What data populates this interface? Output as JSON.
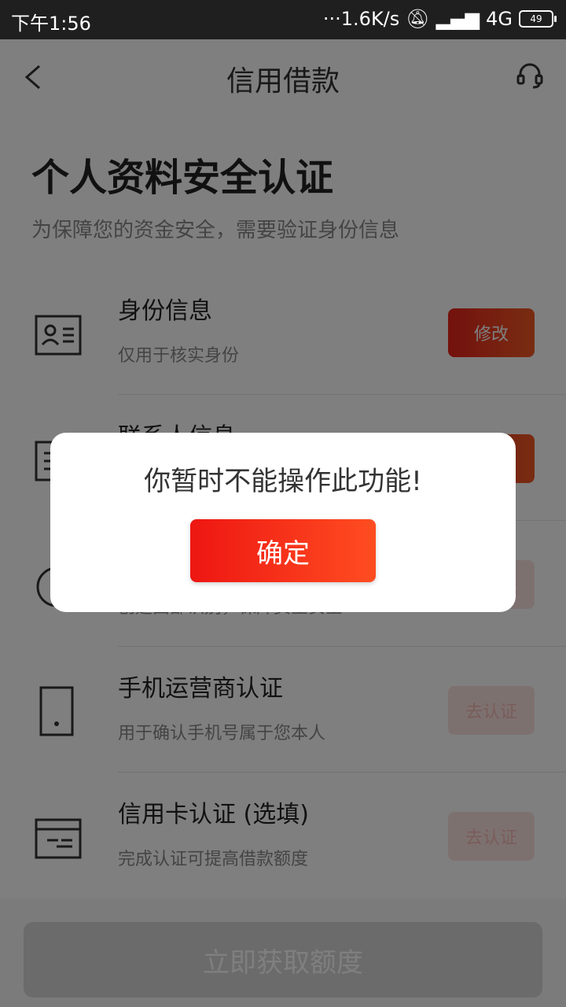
{
  "status_bar": {
    "time": "下午1:56",
    "speed": "···1.6K/s",
    "network": "4G",
    "battery": "49"
  },
  "header": {
    "title": "信用借款"
  },
  "main": {
    "heading": "个人资料安全认证",
    "subheading": "为保障您的资金安全，需要验证身份信息",
    "items": [
      {
        "title": "身份信息",
        "desc": "仅用于核实身份",
        "button": "修改",
        "icon": "id-card-icon"
      },
      {
        "title": "联系人信息",
        "desc": "",
        "button": "修改",
        "icon": "contacts-icon"
      },
      {
        "title": "",
        "desc": "创建面部识别，保障资金安全",
        "button": "去认证",
        "icon": "face-icon"
      },
      {
        "title": "手机运营商认证",
        "desc": "用于确认手机号属于您本人",
        "button": "去认证",
        "icon": "phone-icon"
      },
      {
        "title": "信用卡认证  (选填)",
        "desc": "完成认证可提高借款额度",
        "button": "去认证",
        "icon": "credit-card-icon"
      }
    ]
  },
  "footer": {
    "submit_label": "立即获取额度"
  },
  "dialog": {
    "message": "你暂时不能操作此功能!",
    "confirm_label": "确定"
  },
  "colors": {
    "accent": "#ea2b1b",
    "overlay": "#000000"
  }
}
